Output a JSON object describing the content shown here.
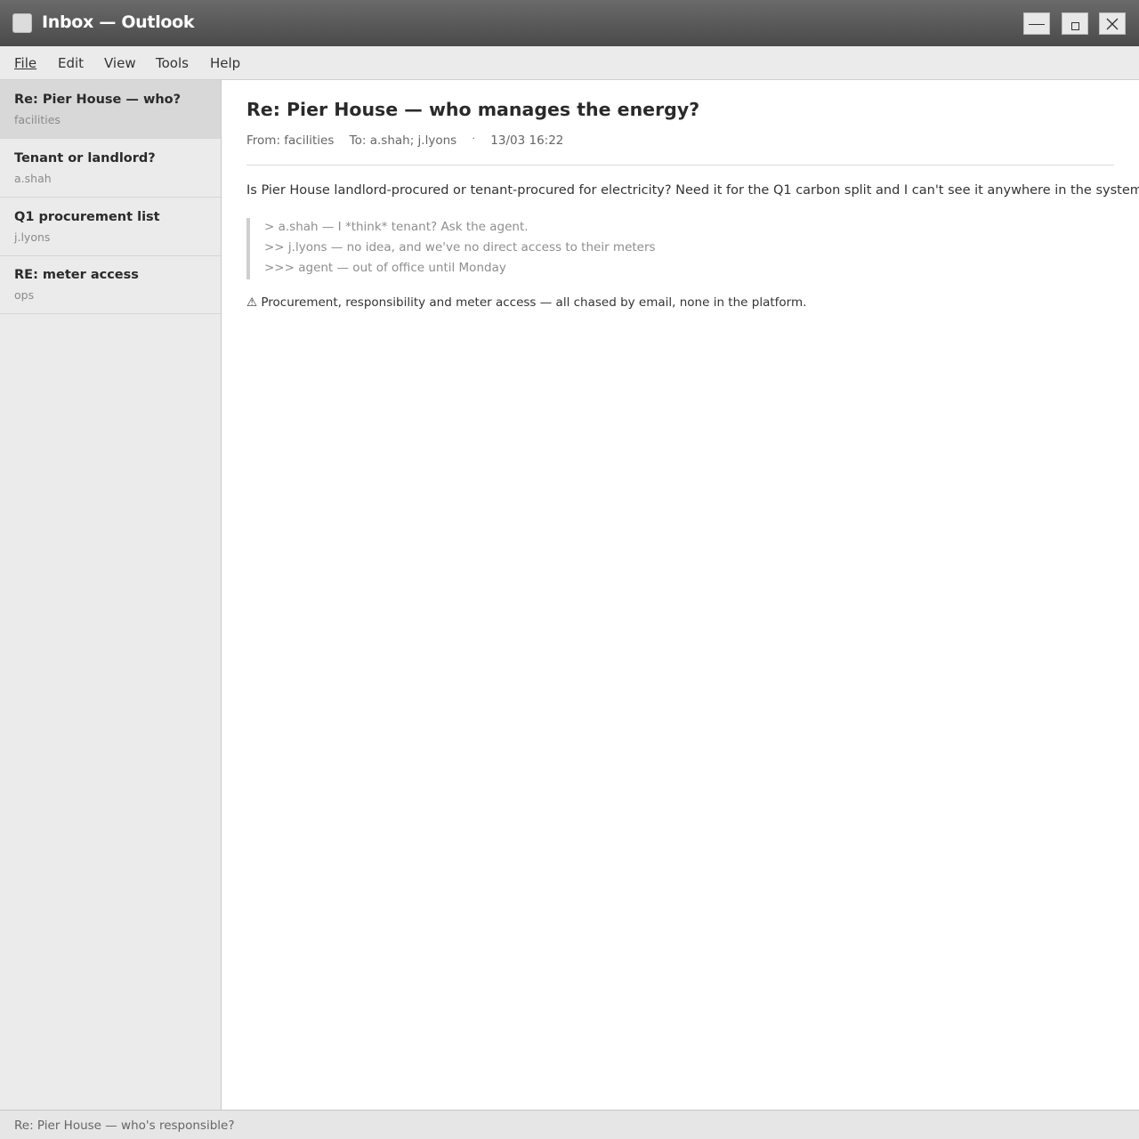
{
  "window": {
    "title": "Inbox — Outlook",
    "controls": {
      "minimize_icon": "minimize-icon",
      "maximize_icon": "maximize-icon",
      "close_icon": "close-icon"
    }
  },
  "menu": {
    "items": [
      {
        "label": "File"
      },
      {
        "label": "Edit"
      },
      {
        "label": "View"
      },
      {
        "label": "Tools"
      },
      {
        "label": "Help"
      }
    ]
  },
  "sidebar": {
    "messages": [
      {
        "subject": "Re: Pier House — who?",
        "sender": "facilities",
        "selected": true
      },
      {
        "subject": "Tenant or landlord?",
        "sender": "a.shah",
        "selected": false
      },
      {
        "subject": "Q1 procurement list",
        "sender": "j.lyons",
        "selected": false
      },
      {
        "subject": "RE: meter access",
        "sender": "ops",
        "selected": false
      }
    ]
  },
  "email": {
    "subject": "Re: Pier House — who manages the energy?",
    "from": "From: facilities",
    "to": "To: a.shah; j.lyons",
    "separator": "·",
    "date": "13/03 16:22",
    "body": "Is Pier House landlord-procured or tenant-procured for electricity? Need it for the Q1 carbon split and I can't see it anywhere in the system.",
    "quotes": [
      "> a.shah — I *think* tenant? Ask the agent.",
      ">> j.lyons — no idea, and we've no direct access to their meters",
      ">>> agent — out of office until Monday"
    ],
    "warning": "⚠ Procurement, responsibility and meter access — all chased by email, none in the platform."
  },
  "status": {
    "text": "Re: Pier House — who's responsible?"
  },
  "colors": {
    "titlebar": "#555555",
    "menubar": "#ebebeb",
    "sidebar": "#ebebeb",
    "selected_item": "#d8d8d8"
  }
}
